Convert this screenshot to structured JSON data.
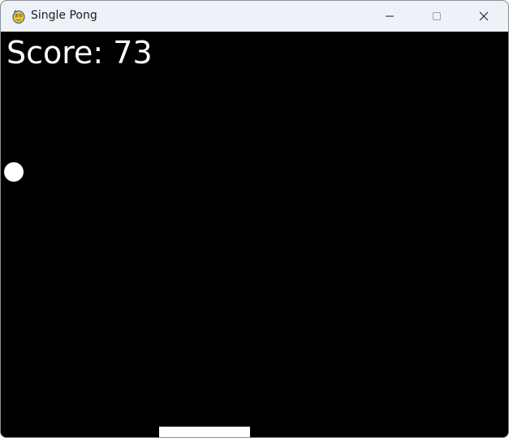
{
  "window": {
    "title": "Single Pong",
    "app_icon": "pygame-snake-icon",
    "controls": {
      "minimize_icon": "minimize-icon",
      "maximize_icon": "maximize-icon",
      "close_icon": "close-icon"
    }
  },
  "game": {
    "score_text": "Score: 73",
    "background_color": "#000000",
    "foreground_color": "#ffffff"
  }
}
